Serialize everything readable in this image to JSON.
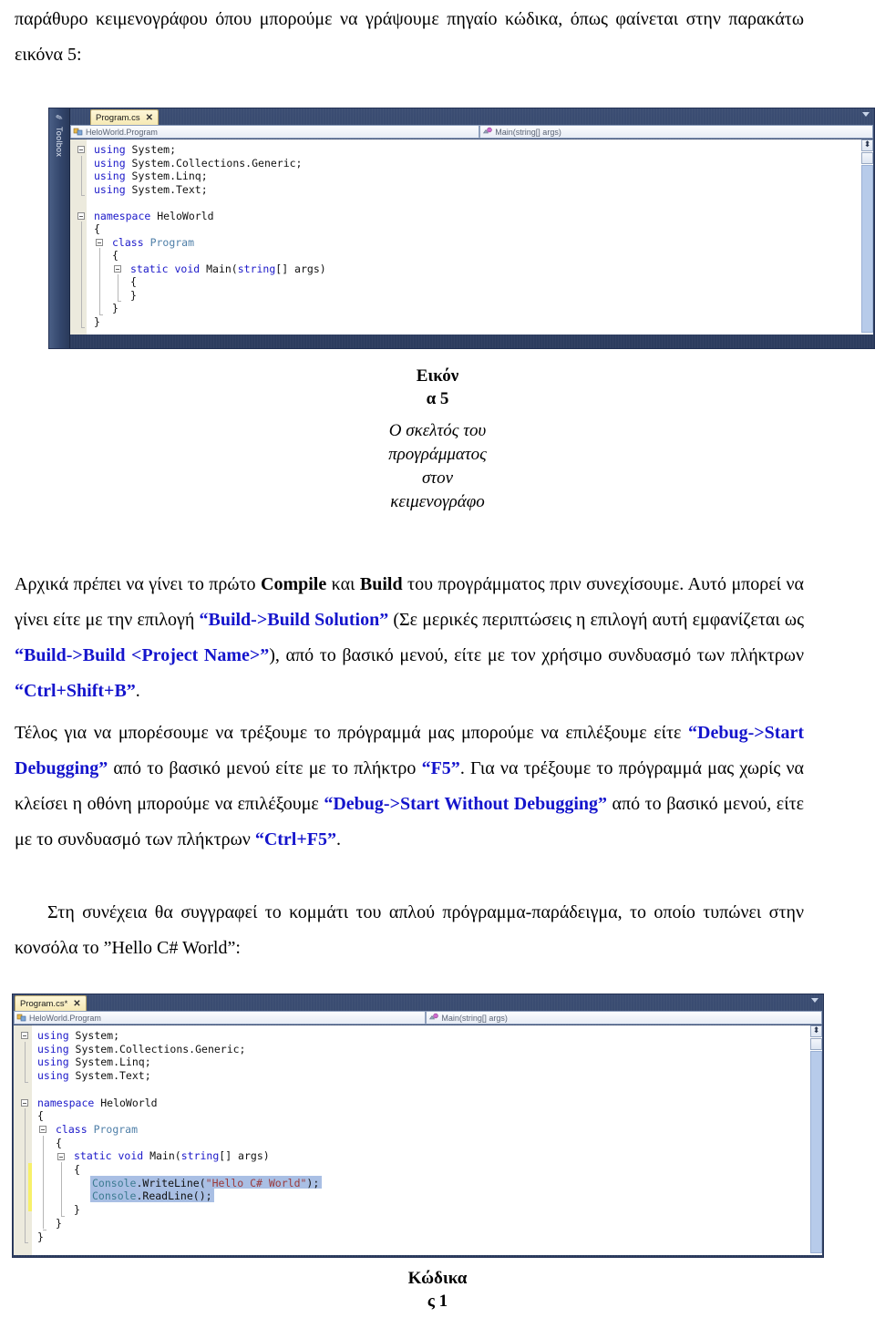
{
  "document": {
    "intro_paragraph_parts": [
      "παράθυρο κειμενογράφου όπου μπορούμε να γράψουμε πηγαίο κώδικα, όπως φαίνεται στην παρακάτω εικόνα 5:"
    ],
    "body_line1_a": "Αρχικά πρέπει να γίνει το πρώτο ",
    "body_b1": "Compile",
    "body_line1_b": " και ",
    "body_b2": "Build",
    "body_line1_c": " του προγράμματος πριν συνεχίσουμε. Αυτό μπορεί να γίνει είτε με την επιλογή ",
    "kbd_build_solution": "“Build->Build Solution”",
    "body_line2_a": " (Σε μερικές περιπτώσεις η επιλογή αυτή εμφανίζεται ως ",
    "kbd_build_project": "“Build->Build <Project Name>”",
    "body_line2_b": "), από το βασικό μενού, είτε με τον χρήσιμο συνδυασμό των πλήκτρων ",
    "kbd_ctrl_shift_b": "“Ctrl+Shift+B”",
    "body_line2_c": ".",
    "body_line3_a": "Τέλος για να μπορέσουμε να τρέξουμε το πρόγραμμά μας μπορούμε να επιλέξουμε είτε ",
    "kbd_start_debugging": "“Debug->Start Debugging”",
    "body_line3_b": " από το βασικό μενού είτε με το πλήκτρο ",
    "kbd_f5": "“F5”",
    "body_line3_c": ". Για να τρέξουμε το πρόγραμμά μας χωρίς να κλείσει η οθόνη μπορούμε να επιλέξουμε ",
    "kbd_start_without_debugging": "“Debug->Start Without Debugging”",
    "body_line3_d": " από το βασικό μενού, είτε με το συνδυασμό των πλήκτρων ",
    "kbd_ctrl_f5": "“Ctrl+F5”",
    "body_line3_e": ".",
    "body_line4": "Στη συνέχεια θα συγγραφεί το κομμάτι του απλού πρόγραμμα-παράδειγμα, το οποίο τυπώνει στην κονσόλα το ”Hello C# World”:"
  },
  "figure1": {
    "caption_title_line1": "Εικόν",
    "caption_title_line2": "α 5",
    "caption_body_line1": "Ο σκελτός του",
    "caption_body_line2": "προγράμματος",
    "caption_body_line3": "στον",
    "caption_body_line4": "κειμενογράφο",
    "rail_label": "Toolbox",
    "rail_icon": "tools-icon",
    "tab_label": "Program.cs",
    "tab_close": "✕",
    "combo_left_value": "HeloWorld.Program",
    "combo_right_value": "Main(string[] args)",
    "code_lines": [
      {
        "indent": 0,
        "tokens": [
          {
            "t": "using",
            "c": "kw"
          },
          {
            "t": " System;",
            "c": "pln"
          }
        ]
      },
      {
        "indent": 0,
        "tokens": [
          {
            "t": "using",
            "c": "kw"
          },
          {
            "t": " System.Collections.Generic;",
            "c": "pln"
          }
        ]
      },
      {
        "indent": 0,
        "tokens": [
          {
            "t": "using",
            "c": "kw"
          },
          {
            "t": " System.Linq;",
            "c": "pln"
          }
        ]
      },
      {
        "indent": 0,
        "tokens": [
          {
            "t": "using",
            "c": "kw"
          },
          {
            "t": " System.Text;",
            "c": "pln"
          }
        ]
      },
      {
        "indent": 0,
        "tokens": [
          {
            "t": "",
            "c": "pln"
          }
        ]
      },
      {
        "indent": 0,
        "tokens": [
          {
            "t": "namespace",
            "c": "kw"
          },
          {
            "t": " HeloWorld",
            "c": "pln"
          }
        ]
      },
      {
        "indent": 0,
        "tokens": [
          {
            "t": "{",
            "c": "pln"
          }
        ]
      },
      {
        "indent": 1,
        "tokens": [
          {
            "t": "class",
            "c": "kw"
          },
          {
            "t": " ",
            "c": "pln"
          },
          {
            "t": "Program",
            "c": "typ"
          }
        ]
      },
      {
        "indent": 1,
        "tokens": [
          {
            "t": "{",
            "c": "pln"
          }
        ]
      },
      {
        "indent": 2,
        "tokens": [
          {
            "t": "static",
            "c": "kw"
          },
          {
            "t": " ",
            "c": "pln"
          },
          {
            "t": "void",
            "c": "kw"
          },
          {
            "t": " Main(",
            "c": "pln"
          },
          {
            "t": "string",
            "c": "kw"
          },
          {
            "t": "[] args)",
            "c": "pln"
          }
        ]
      },
      {
        "indent": 2,
        "tokens": [
          {
            "t": "{",
            "c": "pln"
          }
        ]
      },
      {
        "indent": 2,
        "tokens": [
          {
            "t": "}",
            "c": "pln"
          }
        ]
      },
      {
        "indent": 1,
        "tokens": [
          {
            "t": "}",
            "c": "pln"
          }
        ]
      },
      {
        "indent": 0,
        "tokens": [
          {
            "t": "}",
            "c": "pln"
          }
        ]
      }
    ]
  },
  "figure2": {
    "caption_title_line1": "Κώδικα",
    "caption_title_line2": "ς 1",
    "tab_label": "Program.cs*",
    "tab_close": "✕",
    "combo_left_value": "HeloWorld.Program",
    "combo_right_value": "Main(string[] args)",
    "code_lines": [
      {
        "indent": 0,
        "tokens": [
          {
            "t": "using",
            "c": "kw"
          },
          {
            "t": " System;",
            "c": "pln"
          }
        ]
      },
      {
        "indent": 0,
        "tokens": [
          {
            "t": "using",
            "c": "kw"
          },
          {
            "t": " System.Collections.Generic;",
            "c": "pln"
          }
        ]
      },
      {
        "indent": 0,
        "tokens": [
          {
            "t": "using",
            "c": "kw"
          },
          {
            "t": " System.Linq;",
            "c": "pln"
          }
        ]
      },
      {
        "indent": 0,
        "tokens": [
          {
            "t": "using",
            "c": "kw"
          },
          {
            "t": " System.Text;",
            "c": "pln"
          }
        ]
      },
      {
        "indent": 0,
        "tokens": [
          {
            "t": "",
            "c": "pln"
          }
        ]
      },
      {
        "indent": 0,
        "tokens": [
          {
            "t": "namespace",
            "c": "kw"
          },
          {
            "t": " HeloWorld",
            "c": "pln"
          }
        ]
      },
      {
        "indent": 0,
        "tokens": [
          {
            "t": "{",
            "c": "pln"
          }
        ]
      },
      {
        "indent": 1,
        "tokens": [
          {
            "t": "class",
            "c": "kw"
          },
          {
            "t": " ",
            "c": "pln"
          },
          {
            "t": "Program",
            "c": "typ"
          }
        ]
      },
      {
        "indent": 1,
        "tokens": [
          {
            "t": "{",
            "c": "pln"
          }
        ]
      },
      {
        "indent": 2,
        "tokens": [
          {
            "t": "static",
            "c": "kw"
          },
          {
            "t": " ",
            "c": "pln"
          },
          {
            "t": "void",
            "c": "kw"
          },
          {
            "t": " Main(",
            "c": "pln"
          },
          {
            "t": "string",
            "c": "kw"
          },
          {
            "t": "[] args)",
            "c": "pln"
          }
        ]
      },
      {
        "indent": 2,
        "tokens": [
          {
            "t": "{",
            "c": "pln"
          }
        ]
      },
      {
        "indent": 3,
        "selected": true,
        "tokens": [
          {
            "t": "Console",
            "c": "cls"
          },
          {
            "t": ".WriteLine(",
            "c": "pln"
          },
          {
            "t": "\"Hello C# World\"",
            "c": "str"
          },
          {
            "t": ");",
            "c": "pln"
          }
        ]
      },
      {
        "indent": 3,
        "selected": true,
        "tokens": [
          {
            "t": "Console",
            "c": "cls"
          },
          {
            "t": ".ReadLine();",
            "c": "pln"
          }
        ]
      },
      {
        "indent": 2,
        "tokens": [
          {
            "t": "}",
            "c": "pln"
          }
        ]
      },
      {
        "indent": 1,
        "tokens": [
          {
            "t": "}",
            "c": "pln"
          }
        ]
      },
      {
        "indent": 0,
        "tokens": [
          {
            "t": "}",
            "c": "pln"
          }
        ]
      }
    ]
  },
  "colors": {
    "keyword": "#1b18c9",
    "type": "#4f7fa8",
    "string": "#9a3a3a",
    "class": "#3c7b91",
    "selection": "#a9bfe4",
    "change_marker": "#f7f06a",
    "chrome": "#2e3f61",
    "link_blue": "#1414CC"
  }
}
